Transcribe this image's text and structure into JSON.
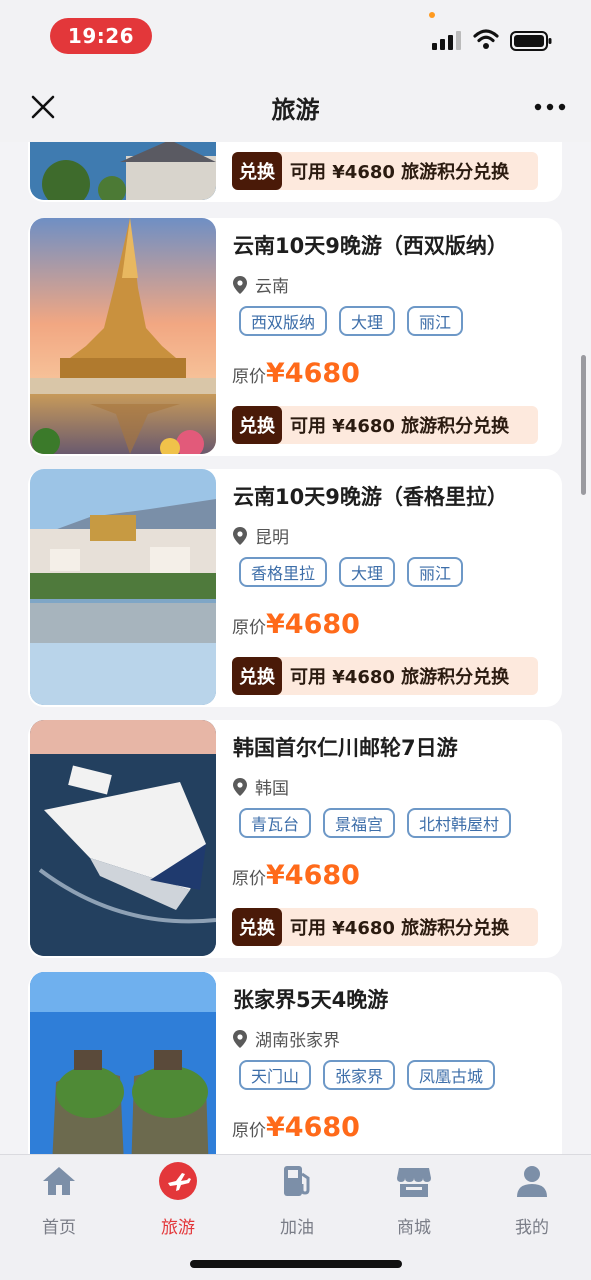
{
  "status_bar": {
    "time": "19:26"
  },
  "nav": {
    "title": "旅游"
  },
  "partial_card": {
    "redeem_badge": "兑换",
    "redeem_text": "可用 ¥4680 旅游积分兑换"
  },
  "cards": [
    {
      "title": "云南10天9晚游（西双版纳）",
      "location": "云南",
      "tags": [
        "西双版纳",
        "大理",
        "丽江"
      ],
      "price_label": "原价",
      "price": "¥4680",
      "redeem_badge": "兑换",
      "redeem_text": "可用 ¥4680 旅游积分兑换"
    },
    {
      "title": "云南10天9晚游（香格里拉）",
      "location": "昆明",
      "tags": [
        "香格里拉",
        "大理",
        "丽江"
      ],
      "price_label": "原价",
      "price": "¥4680",
      "redeem_badge": "兑换",
      "redeem_text": "可用 ¥4680 旅游积分兑换"
    },
    {
      "title": "韩国首尔仁川邮轮7日游",
      "location": "韩国",
      "tags": [
        "青瓦台",
        "景福宫",
        "北村韩屋村"
      ],
      "price_label": "原价",
      "price": "¥4680",
      "redeem_badge": "兑换",
      "redeem_text": "可用 ¥4680 旅游积分兑换"
    },
    {
      "title": "张家界5天4晚游",
      "location": "湖南张家界",
      "tags": [
        "天门山",
        "张家界",
        "凤凰古城"
      ],
      "price_label": "原价",
      "price": "¥4680"
    }
  ],
  "tabbar": {
    "items": [
      {
        "label": "首页",
        "icon": "home-icon"
      },
      {
        "label": "旅游",
        "icon": "plane-icon",
        "active": true
      },
      {
        "label": "加油",
        "icon": "fuel-icon"
      },
      {
        "label": "商城",
        "icon": "store-icon"
      },
      {
        "label": "我的",
        "icon": "profile-icon"
      }
    ]
  },
  "colors": {
    "accent": "#e3373a",
    "price": "#ff6a1a",
    "tag_border": "#6d98c7",
    "redeem_badge": "#4a1a08"
  }
}
